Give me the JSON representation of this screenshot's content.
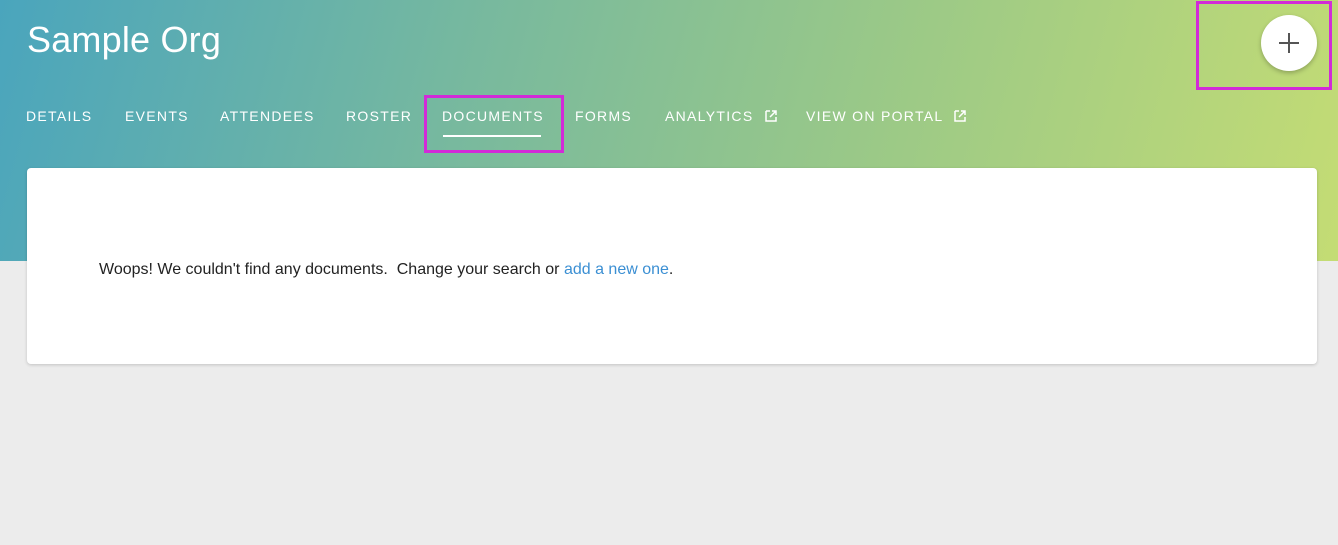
{
  "header": {
    "title": "Sample Org",
    "fab_icon": "plus-icon"
  },
  "tabs": [
    {
      "label": "DETAILS",
      "active": false
    },
    {
      "label": "EVENTS",
      "active": false
    },
    {
      "label": "ATTENDEES",
      "active": false
    },
    {
      "label": "ROSTER",
      "active": false
    },
    {
      "label": "DOCUMENTS",
      "active": true
    },
    {
      "label": "FORMS",
      "active": false
    },
    {
      "label": "ANALYTICS",
      "active": false,
      "icon": "external-link-icon"
    },
    {
      "label": "VIEW ON PORTAL",
      "active": false,
      "icon": "external-link-icon"
    }
  ],
  "empty_state": {
    "message": "Woops! We couldn't find any documents.  Change your search or ",
    "link_text": "add a new one",
    "suffix": "."
  },
  "colors": {
    "highlight": "#d22ad8",
    "link": "#3b8fd3",
    "background": "#ececec"
  }
}
